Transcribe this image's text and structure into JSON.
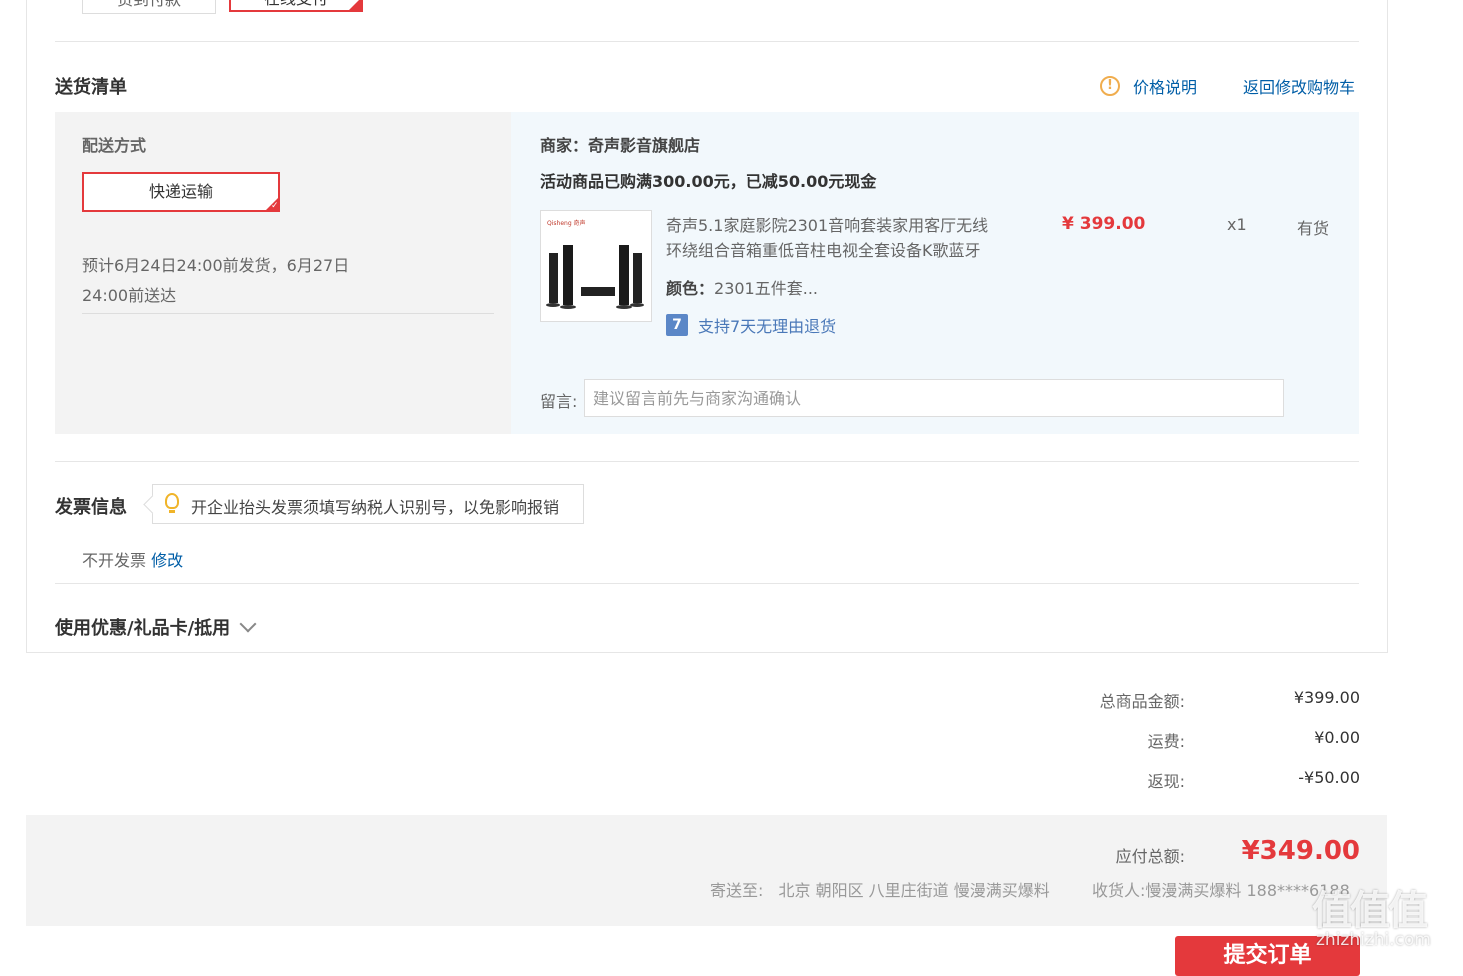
{
  "top_tabs": [
    {
      "label": "货到付款"
    },
    {
      "label": "在线支付"
    }
  ],
  "delivery": {
    "title": "送货清单",
    "price_note": "价格说明",
    "back_link": "返回修改购物车",
    "method_label": "配送方式",
    "method_value": "快递运输",
    "estimate_line1": "预计6月24日24:00前发货，6月27日",
    "estimate_line2": "24:00前送达"
  },
  "store": {
    "merchant": "商家：奇声影音旗舰店",
    "promo": "活动商品已购满300.00元，已减50.00元现金"
  },
  "product": {
    "title_line1": "奇声5.1家庭影院2301音响套装家用客厅无线",
    "title_line2": "环绕组合音箱重低音柱电视全套设备K歌蓝牙",
    "color_label": "颜色：",
    "color_value": "2301五件套...",
    "return_policy": "支持7天无理由退货",
    "return_badge": "7",
    "price": "¥ 399.00",
    "quantity": "x1",
    "stock": "有货",
    "image_brand": "Qisheng 奇声"
  },
  "message": {
    "label": "留言:",
    "placeholder": "建议留言前先与商家沟通确认"
  },
  "invoice": {
    "title": "发票信息",
    "tip": "开企业抬头发票须填写纳税人识别号，以免影响报销",
    "status": "不开发票",
    "edit": "修改"
  },
  "coupon": {
    "title": "使用优惠/礼品卡/抵用"
  },
  "summary": {
    "goods_label": "总商品金额:",
    "goods_value": "¥399.00",
    "shipping_label": "运费:",
    "shipping_value": "¥0.00",
    "cashback_label": "返现:",
    "cashback_value": "-¥50.00"
  },
  "total": {
    "label": "应付总额:",
    "value": "¥349.00",
    "address_label": "寄送至:",
    "address": "北京 朝阳区 八里庄街道 慢漫满买爆料",
    "receiver_label": "收货人:",
    "receiver": "慢漫满买爆料 188****6188"
  },
  "submit": {
    "label": "提交订单"
  },
  "watermark": {
    "logo": "值值值",
    "url": "zhizhizhi.com"
  },
  "colors": {
    "accent_red": "#e4393c",
    "link_blue": "#005ea7",
    "panel_grey": "#f3f3f3",
    "panel_blue": "#f2f8fc",
    "warning_orange": "#f0ad4e"
  }
}
